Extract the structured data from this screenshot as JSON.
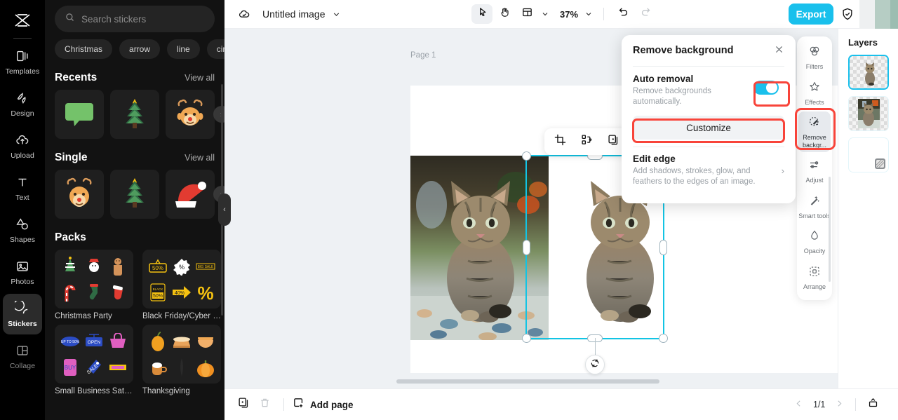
{
  "left_rail": {
    "logo_icon": "capcut-logo-icon",
    "items": [
      {
        "label": "Templates",
        "icon": "templates-icon",
        "active": false
      },
      {
        "label": "Design",
        "icon": "design-icon",
        "active": false
      },
      {
        "label": "Upload",
        "icon": "upload-cloud-icon",
        "active": false
      },
      {
        "label": "Text",
        "icon": "text-t-icon",
        "active": false
      },
      {
        "label": "Shapes",
        "icon": "shapes-icon",
        "active": false
      },
      {
        "label": "Photos",
        "icon": "photo-icon",
        "active": false
      },
      {
        "label": "Stickers",
        "icon": "sticker-icon",
        "active": true
      },
      {
        "label": "Collage",
        "icon": "collage-icon",
        "active": false
      }
    ]
  },
  "stickers_panel": {
    "search": {
      "placeholder": "Search stickers",
      "icon": "search-icon"
    },
    "chips": [
      "Christmas",
      "arrow",
      "line",
      "circle"
    ],
    "sections": [
      {
        "title": "Recents",
        "view_all": "View all"
      },
      {
        "title": "Single",
        "view_all": "View all"
      },
      {
        "title": "Packs"
      }
    ],
    "packs": [
      {
        "name": "Christmas Party"
      },
      {
        "name": "Black Friday/Cyber M..."
      },
      {
        "name": "Small Business Saturd..."
      },
      {
        "name": "Thanksgiving"
      }
    ],
    "collapse_icon": "chevron-left-icon"
  },
  "topbar": {
    "cloud_icon": "cloud-saved-icon",
    "doc_title": "Untitled image",
    "title_caret_icon": "chevron-down-icon",
    "tools": [
      {
        "name": "select",
        "icon": "cursor-arrow-icon",
        "selected": true
      },
      {
        "name": "hand",
        "icon": "hand-icon",
        "selected": false
      },
      {
        "name": "layout",
        "icon": "layout-icon",
        "selected": false
      }
    ],
    "layout_caret_icon": "chevron-down-icon",
    "zoom_value": "37%",
    "zoom_caret_icon": "chevron-down-icon",
    "undo_icon": "undo-icon",
    "redo_icon": "redo-icon",
    "export_label": "Export",
    "shield_icon": "shield-check-icon"
  },
  "canvas": {
    "page_label": "Page 1",
    "float_tools": [
      {
        "name": "crop",
        "icon": "crop-icon"
      },
      {
        "name": "smart-cutout",
        "icon": "cutout-nodes-icon"
      },
      {
        "name": "duplicate",
        "icon": "duplicate-icon"
      }
    ],
    "rotate_icon": "rotate-icon",
    "selection_color": "#12c4e4"
  },
  "remove_background_panel": {
    "title": "Remove background",
    "close_icon": "close-icon",
    "auto_removal": {
      "title": "Auto removal",
      "description": "Remove backgrounds automatically.",
      "toggle_on": true,
      "toggle_color": "#19c0ec"
    },
    "customize_label": "Customize",
    "edit_edge": {
      "title": "Edit edge",
      "description": "Add shadows, strokes, glow, and feathers to the edges of an image.",
      "chevron_icon": "chevron-right-icon"
    },
    "highlight_color": "#f8443a"
  },
  "tool_rail": {
    "items": [
      {
        "label": "Filters",
        "icon": "filters-icon",
        "active": false
      },
      {
        "label": "Effects",
        "icon": "effects-star-icon",
        "active": false
      },
      {
        "label": "Remove backgr...",
        "icon": "remove-background-icon",
        "active": true
      },
      {
        "label": "Adjust",
        "icon": "adjust-sliders-icon",
        "active": false
      },
      {
        "label": "Smart tools",
        "icon": "smart-tools-wand-icon",
        "active": false
      },
      {
        "label": "Opacity",
        "icon": "opacity-drop-icon",
        "active": false
      },
      {
        "label": "Arrange",
        "icon": "arrange-icon",
        "active": false
      }
    ]
  },
  "layers_panel": {
    "title": "Layers",
    "layers": [
      {
        "name": "cutout-cat-layer",
        "selected": true,
        "kind": "transparent-image"
      },
      {
        "name": "original-cat-layer",
        "selected": false,
        "kind": "photo"
      },
      {
        "name": "background-layer",
        "selected": false,
        "kind": "blank",
        "badge_icon": "transparent-badge-icon"
      }
    ]
  },
  "bottom_bar": {
    "duplicate_page_icon": "duplicate-page-icon",
    "delete_icon": "trash-icon",
    "add_page_label": "Add page",
    "add_page_icon": "add-page-icon",
    "prev_icon": "chevron-left-icon",
    "page_indicator": "1/1",
    "next_icon": "chevron-right-icon",
    "present_icon": "present-icon"
  }
}
